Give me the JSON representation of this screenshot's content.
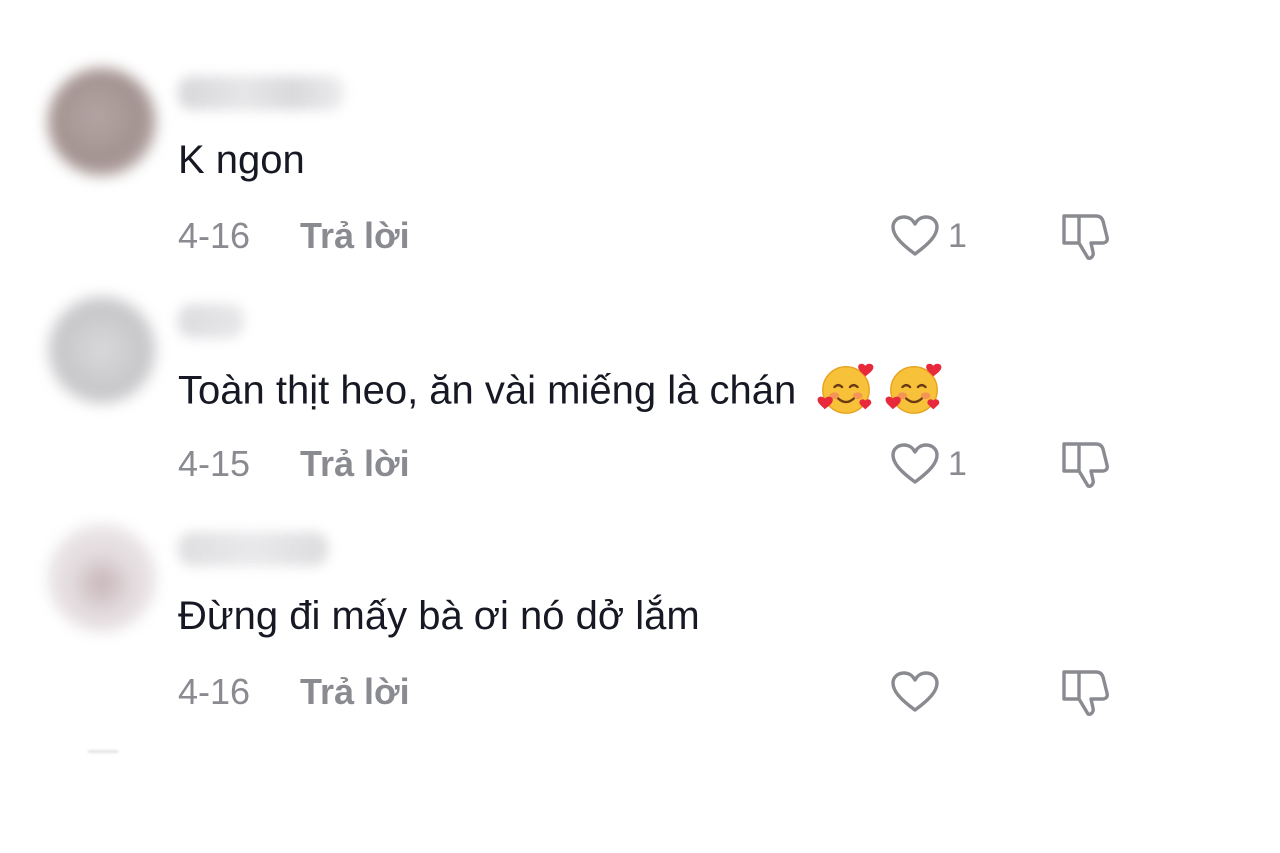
{
  "comments": [
    {
      "text": "K ngon",
      "date": "4-16",
      "reply_label": "Trả lời",
      "likes": "1",
      "avatar_color": "#a99a98",
      "emoji": []
    },
    {
      "text": "Toàn thịt heo, ăn vài miếng là chán",
      "date": "4-15",
      "reply_label": "Trả lời",
      "likes": "1",
      "avatar_color": "#c9c9cc",
      "emoji": [
        "smiling-face-with-hearts",
        "smiling-face-with-hearts"
      ]
    },
    {
      "text": "Đừng đi mấy bà ơi nó dở lắm",
      "date": "4-16",
      "reply_label": "Trả lời",
      "likes": "",
      "avatar_color": "#e9e4e6",
      "emoji": []
    }
  ],
  "icons": {
    "like": "heart-outline-icon",
    "dislike": "thumbs-down-icon"
  },
  "colors": {
    "text": "#161823",
    "meta": "#8a8b91"
  }
}
